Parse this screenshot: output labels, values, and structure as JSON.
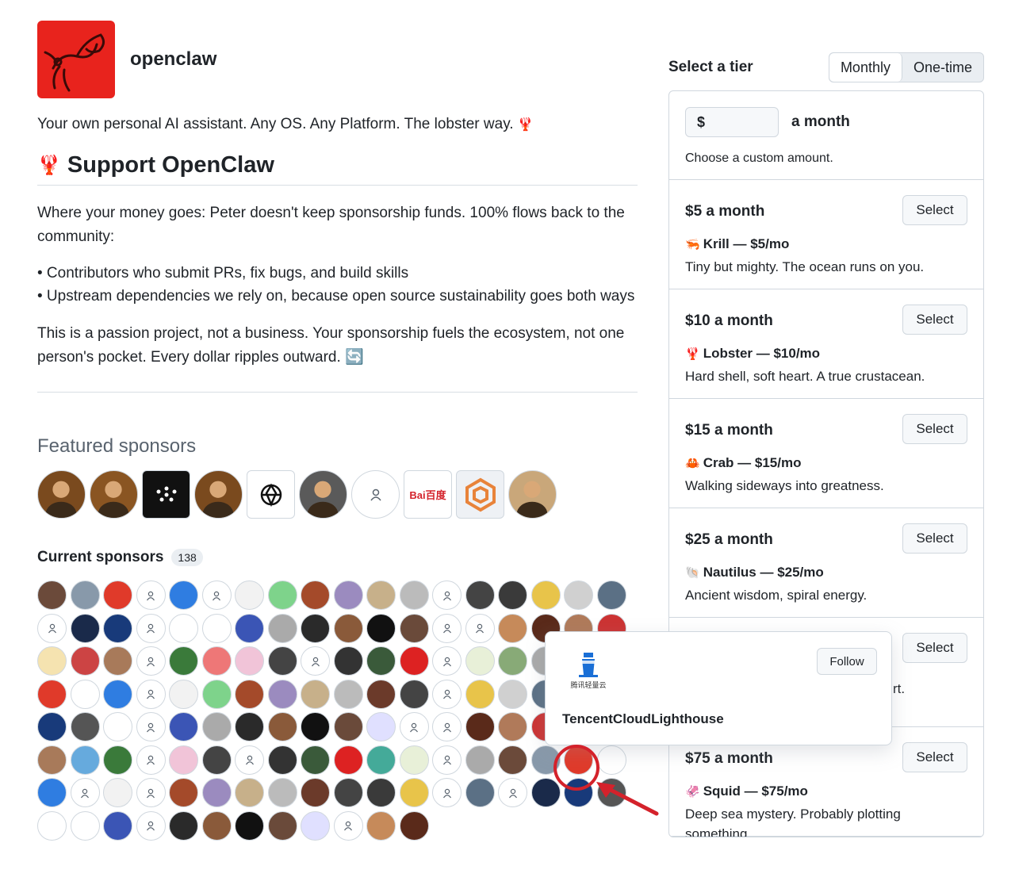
{
  "org": {
    "name": "openclaw",
    "tagline": "Your own personal AI assistant. Any OS. Any Platform. The lobster way.",
    "tagline_emoji": "🦞"
  },
  "support": {
    "heading_emoji": "🦞",
    "heading": "Support OpenClaw",
    "para1": "Where your money goes: Peter doesn't keep sponsorship funds. 100% flows back to the community:",
    "bullets": [
      "• Contributors who submit PRs, fix bugs, and build skills",
      "• Upstream dependencies we rely on, because open source sustainability goes both ways"
    ],
    "para2": "This is a passion project, not a business. Your sponsorship fuels the ecosystem, not one person's pocket. Every dollar ripples outward.",
    "para2_emoji": "🔄"
  },
  "featured": {
    "title": "Featured sponsors",
    "avatars": [
      {
        "icon": "portrait-avatar",
        "color": "#7a4a1e"
      },
      {
        "icon": "portrait-avatar",
        "color": "#8a5522"
      },
      {
        "icon": "dots-logo",
        "color": "#111111"
      },
      {
        "icon": "portrait-avatar",
        "color": "#7a4a1e"
      },
      {
        "icon": "openai-logo",
        "color": "#ffffff"
      },
      {
        "icon": "portrait-avatar",
        "color": "#5a5a5a"
      },
      {
        "icon": "ghost-avatar",
        "color": "#ffffff"
      },
      {
        "icon": "baidu-logo",
        "color": "#ffffff",
        "label": "Bai百度"
      },
      {
        "icon": "hex-logo",
        "color": "#eef1f5"
      },
      {
        "icon": "portrait-avatar",
        "color": "#c9a77a"
      }
    ]
  },
  "current": {
    "title": "Current sponsors",
    "count": "138"
  },
  "tiers": {
    "title": "Select a tier",
    "toggle": {
      "monthly": "Monthly",
      "onetime": "One-time"
    },
    "custom": {
      "currency_placeholder": "$",
      "suffix": "a month",
      "hint": "Choose a custom amount."
    },
    "select_label": "Select",
    "items": [
      {
        "price": "$5 a month",
        "emoji": "🦐",
        "name": "Krill — $5/mo",
        "desc": "Tiny but mighty. The ocean runs on you."
      },
      {
        "price": "$10 a month",
        "emoji": "🦞",
        "name": "Lobster — $10/mo",
        "desc": "Hard shell, soft heart. A true crustacean."
      },
      {
        "price": "$15 a month",
        "emoji": "🦀",
        "name": "Crab — $15/mo",
        "desc": "Walking sideways into greatness."
      },
      {
        "price": "$25 a month",
        "emoji": "🐚",
        "name": "Nautilus — $25/mo",
        "desc": "Ancient wisdom, spiral energy."
      },
      {
        "price": "",
        "emoji": "",
        "name": "",
        "desc": "rt."
      },
      {
        "price": "$75 a month",
        "emoji": "🦑",
        "name": "Squid — $75/mo",
        "desc": "Deep sea mystery. Probably plotting something."
      }
    ]
  },
  "hovercard": {
    "name": "TencentCloudLighthouse",
    "logo_text": "腾讯轻量云",
    "follow_label": "Follow"
  }
}
